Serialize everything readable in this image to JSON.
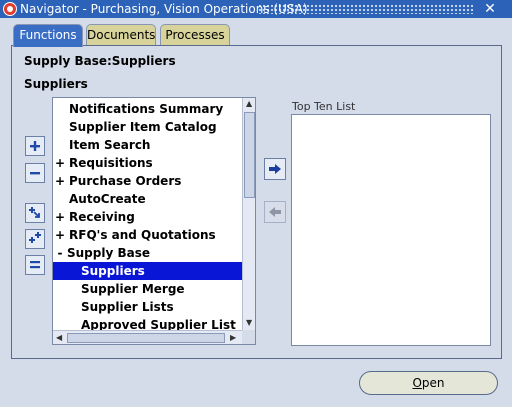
{
  "window": {
    "title": "Navigator - Purchasing, Vision Operations (USA)",
    "close_glyph": "✕"
  },
  "tabs": [
    {
      "label": "Functions",
      "active": true
    },
    {
      "label": "Documents",
      "active": false
    },
    {
      "label": "Processes",
      "active": false
    }
  ],
  "breadcrumb": "Supply Base:Suppliers",
  "section_title": "Suppliers",
  "side_buttons": [
    {
      "icon": "expand-icon"
    },
    {
      "icon": "collapse-icon"
    },
    {
      "icon": "expand-branch-icon"
    },
    {
      "icon": "expand-all-icon"
    },
    {
      "icon": "collapse-all-icon"
    }
  ],
  "tree": {
    "items": [
      {
        "prefix": "",
        "label": "Notifications Summary",
        "level": 0,
        "selected": false
      },
      {
        "prefix": "",
        "label": "Supplier Item Catalog",
        "level": 0,
        "selected": false
      },
      {
        "prefix": "",
        "label": "Item Search",
        "level": 0,
        "selected": false
      },
      {
        "prefix": "+",
        "label": "Requisitions",
        "level": 0,
        "selected": false
      },
      {
        "prefix": "+",
        "label": "Purchase Orders",
        "level": 0,
        "selected": false
      },
      {
        "prefix": "",
        "label": "AutoCreate",
        "level": 0,
        "selected": false
      },
      {
        "prefix": "+",
        "label": "Receiving",
        "level": 0,
        "selected": false
      },
      {
        "prefix": "+",
        "label": "RFQ's and Quotations",
        "level": 0,
        "selected": false
      },
      {
        "prefix": "-",
        "label": "Supply Base",
        "level": -1,
        "selected": false
      },
      {
        "prefix": "",
        "label": "Suppliers",
        "level": 1,
        "selected": true
      },
      {
        "prefix": "",
        "label": "Supplier Merge",
        "level": 1,
        "selected": false
      },
      {
        "prefix": "",
        "label": "Supplier Lists",
        "level": 1,
        "selected": false
      },
      {
        "prefix": "",
        "label": "Approved Supplier List",
        "level": 1,
        "selected": false
      }
    ]
  },
  "top_ten": {
    "label": "Top Ten List"
  },
  "buttons": {
    "add_to_list_icon": "right-arrow-icon",
    "remove_from_list_icon": "left-arrow-icon",
    "open_label": "Open",
    "open_mnemonic": "O",
    "open_rest": "pen"
  },
  "colors": {
    "title_bar": "#2c63b8",
    "active_tab": "#3a6ec4",
    "inactive_tab": "#d8d39a",
    "selection": "#0a16d6",
    "background": "#d4dcea"
  }
}
